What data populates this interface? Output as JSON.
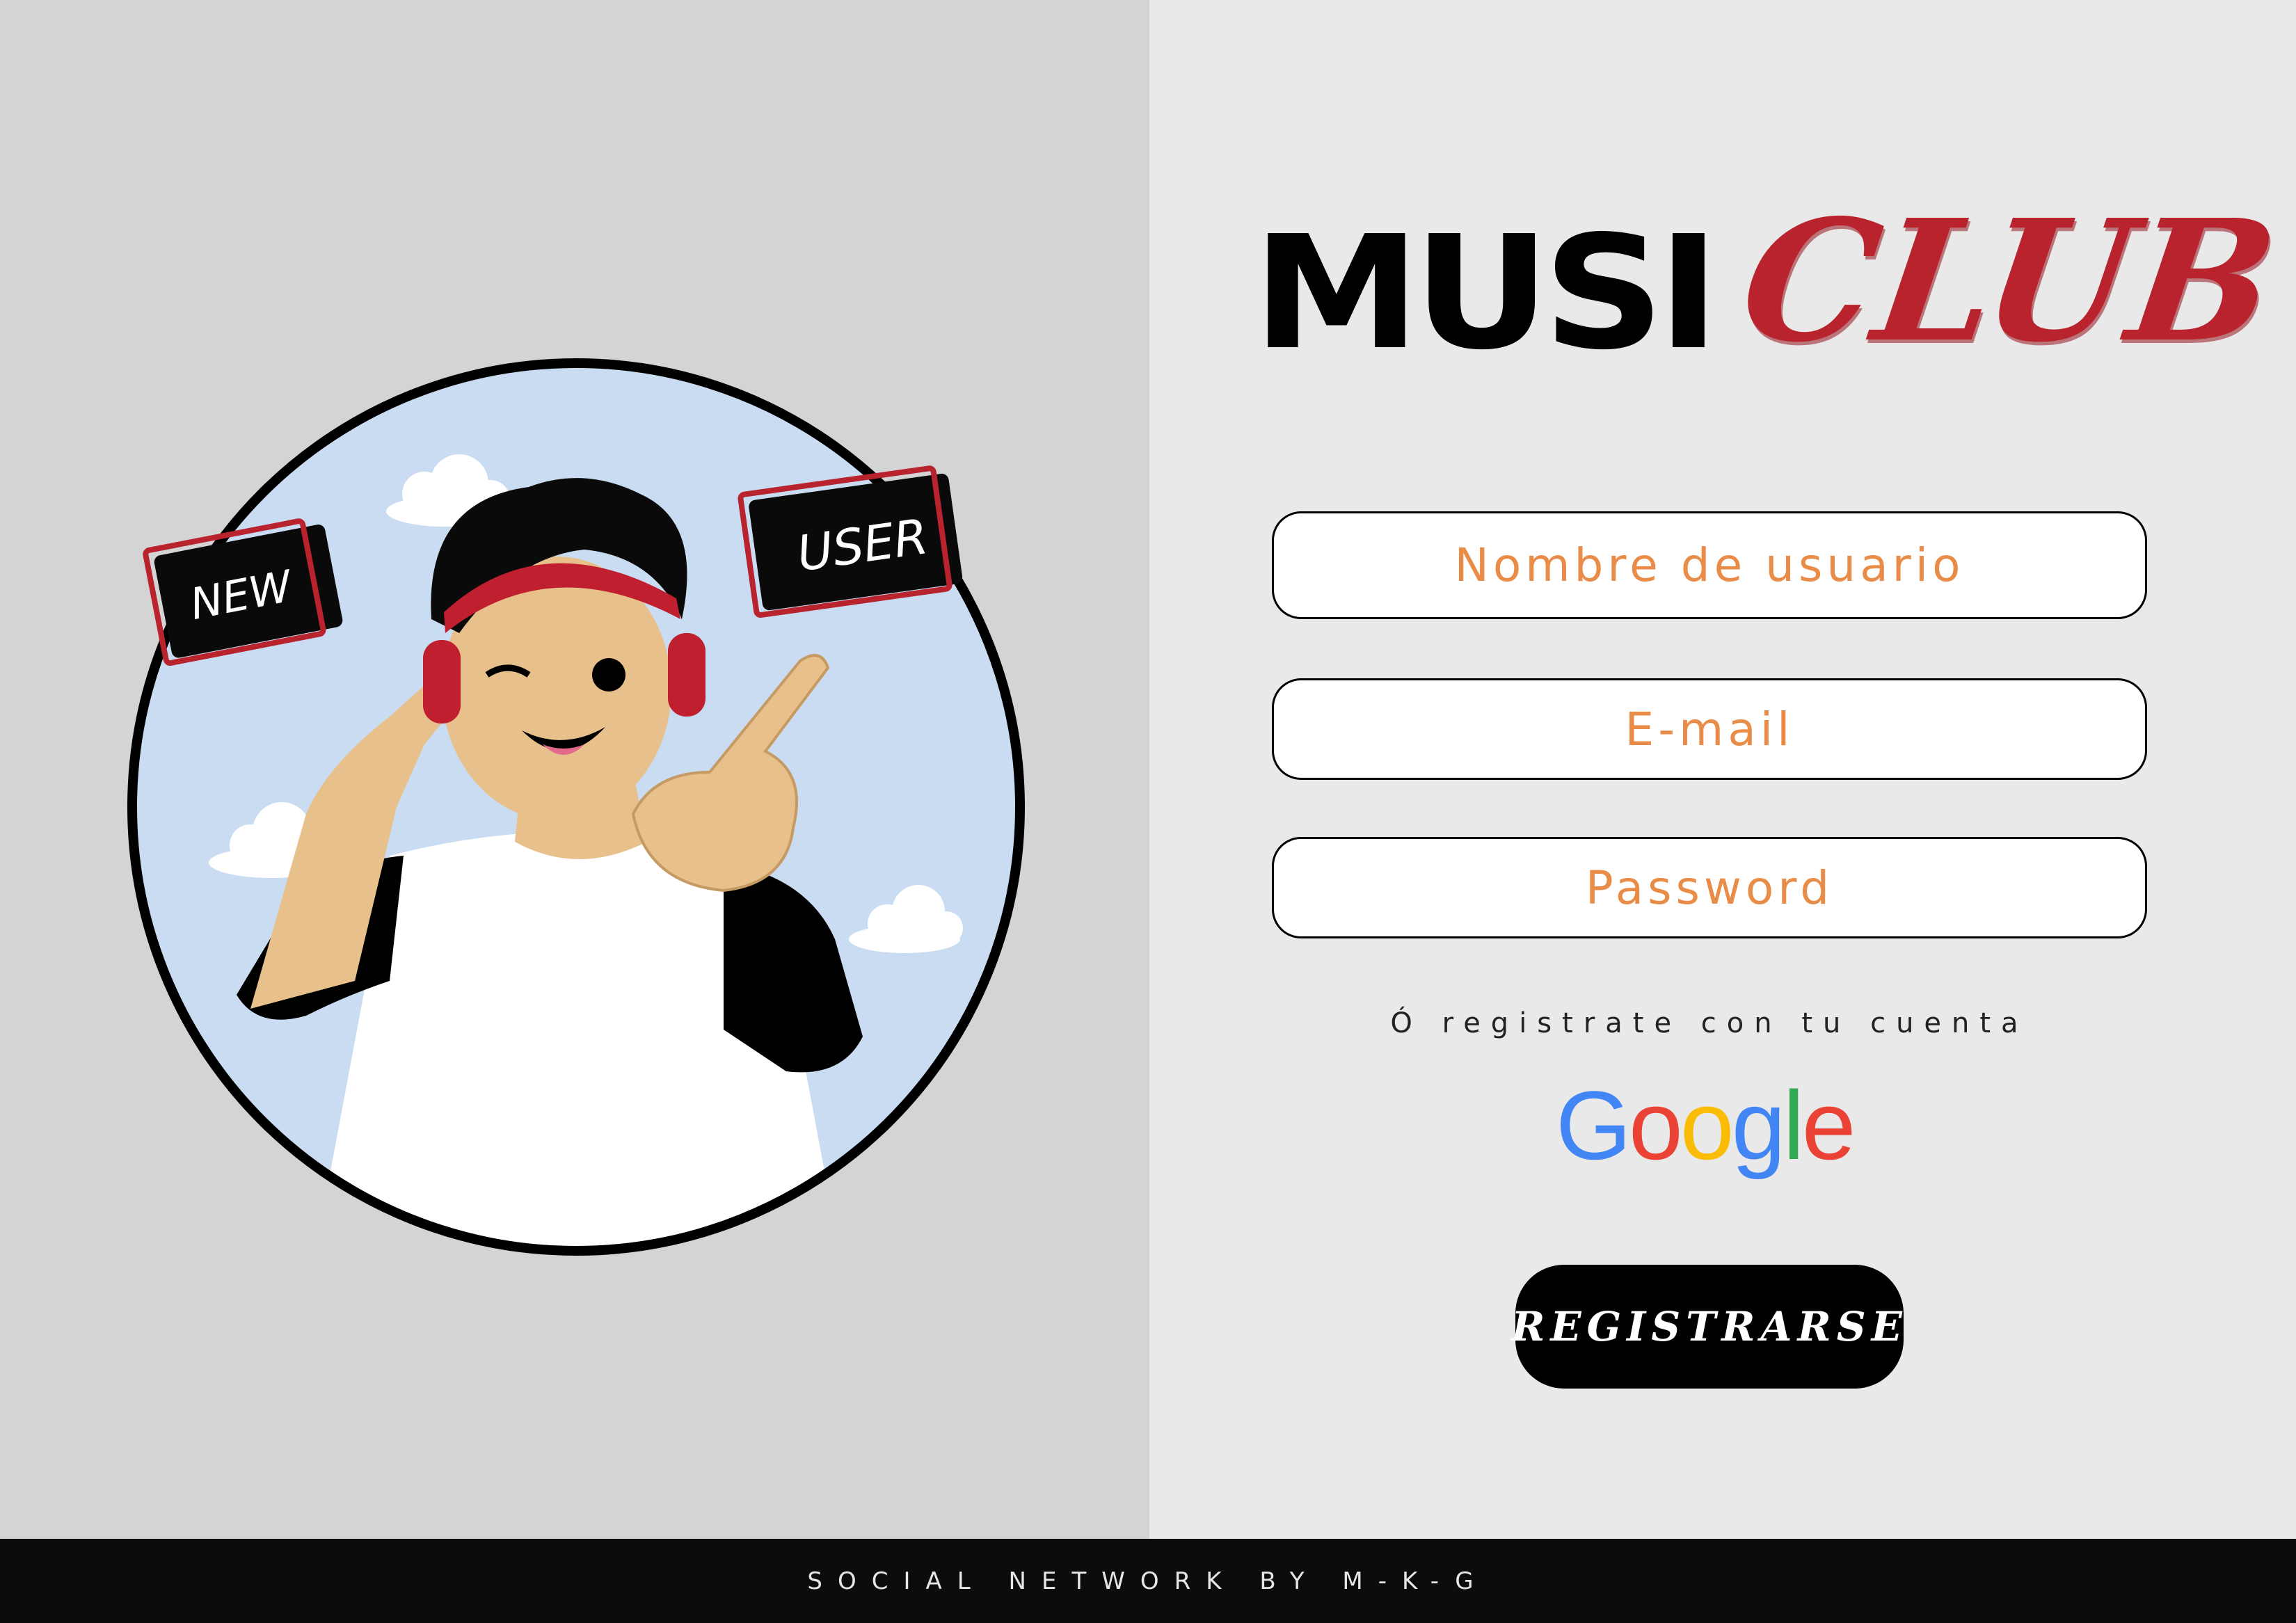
{
  "brand": {
    "logo_dark": "MUSI",
    "logo_accent": "CLUB"
  },
  "illustration": {
    "badge_left": "NEW",
    "badge_right": "USER"
  },
  "form": {
    "username_placeholder": "Nombre de usuario",
    "email_placeholder": "E-mail",
    "password_placeholder": "Password",
    "alt_signup": "Ó registrate con tu cuenta",
    "google_letters": [
      "G",
      "o",
      "o",
      "g",
      "l",
      "e"
    ],
    "register_label": "REGISTRARSE"
  },
  "footer": {
    "text": "SOCIAL NETWORK BY M-K-G"
  },
  "colors": {
    "left_bg": "#d4d4d4",
    "right_bg": "#e9e9e9",
    "footer_bg": "#0d0c0c",
    "accent_red": "#b8232e",
    "placeholder_orange": "#e98c48",
    "google_blue": "#4285f4",
    "google_red": "#ea4335",
    "google_yellow": "#fbbc05",
    "google_green": "#34a853"
  }
}
